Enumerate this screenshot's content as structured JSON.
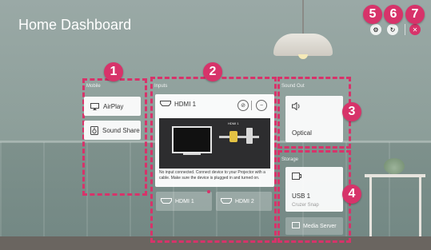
{
  "header": {
    "title": "Home Dashboard"
  },
  "top_controls": {
    "settings_icon": "gear-icon",
    "refresh_icon": "refresh-icon",
    "close_icon": "close-icon"
  },
  "badges": [
    "1",
    "2",
    "3",
    "4",
    "5",
    "6",
    "7"
  ],
  "mobile": {
    "label": "Mobile",
    "items": [
      {
        "label": "AirPlay",
        "icon": "airplay-icon"
      },
      {
        "label": "Sound Share",
        "icon": "speaker-icon"
      }
    ]
  },
  "inputs": {
    "label": "Inputs",
    "active": {
      "label": "HDMI 1"
    },
    "preview_callout": "HDMI 1",
    "description": "No input connected. Connect device to your Projector with a cable. Make sure the device is plugged in and turned on.",
    "other": [
      {
        "label": "HDMI 1"
      },
      {
        "label": "HDMI 2"
      }
    ]
  },
  "sound_out": {
    "label": "Sound Out",
    "value": "Optical"
  },
  "storage": {
    "label": "Storage",
    "device_name": "USB 1",
    "device_sub": "Cruzer Snap",
    "media_server": "Media Server"
  },
  "colors": {
    "accent": "#d7336a",
    "card": "#ffffff"
  }
}
